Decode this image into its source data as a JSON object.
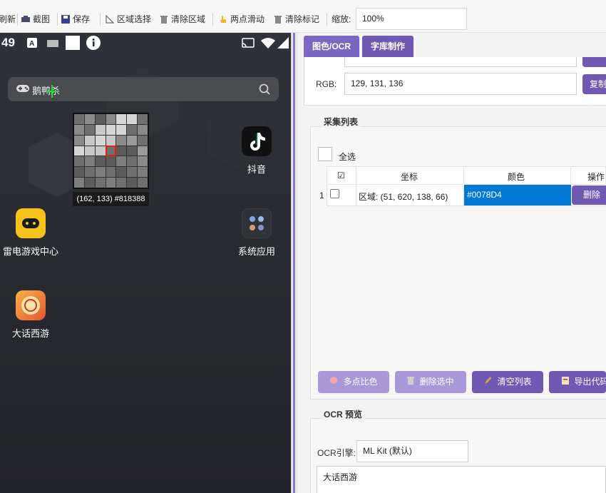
{
  "toolbar": {
    "refresh_label": "刷新",
    "screenshot_label": "截图",
    "save_label": "保存",
    "region_select_label": "区域选择",
    "clear_region_label": "清除区域",
    "two_point_swipe_label": "两点滑动",
    "clear_marks_label": "清除标记",
    "zoom_label": "缩放:",
    "zoom_value": "100%"
  },
  "phone": {
    "time": "49",
    "search_label": "鹅鸭杀",
    "magnifier_readout": "(162, 133) #818388",
    "apps": {
      "douyin": "抖音",
      "leidian": "雷电游戏中心",
      "system": "系统应用",
      "dahua": "大话西游"
    }
  },
  "tabs": [
    {
      "label": "图色/OCR"
    },
    {
      "label": "字库制作"
    }
  ],
  "color_panel": {
    "rgb_label": "RGB:",
    "rgb_value": "129, 131, 136",
    "copy_btn_label": "复制"
  },
  "capture_list": {
    "title": "采集列表",
    "select_all_label": "全选",
    "columns": {
      "check": "☑",
      "coord": "坐标",
      "color": "颜色",
      "action": "操作"
    },
    "rows": [
      {
        "index": "1",
        "coord": "区域: (51, 620, 138, 66)",
        "color": "#0078D4",
        "delete_label": "删除"
      }
    ],
    "buttons": {
      "multi_compare": "多点比色",
      "delete_selected": "删除选中",
      "clear_list": "清空列表",
      "export_code": "导出代码"
    }
  },
  "ocr": {
    "title": "OCR 预览",
    "engine_label": "OCR引擎:",
    "engine_value": "ML Kit (默认)",
    "result_text": "大话西游"
  },
  "colors": {
    "accent": "#6f59b2",
    "selected_color_cell": "#0078d4"
  }
}
